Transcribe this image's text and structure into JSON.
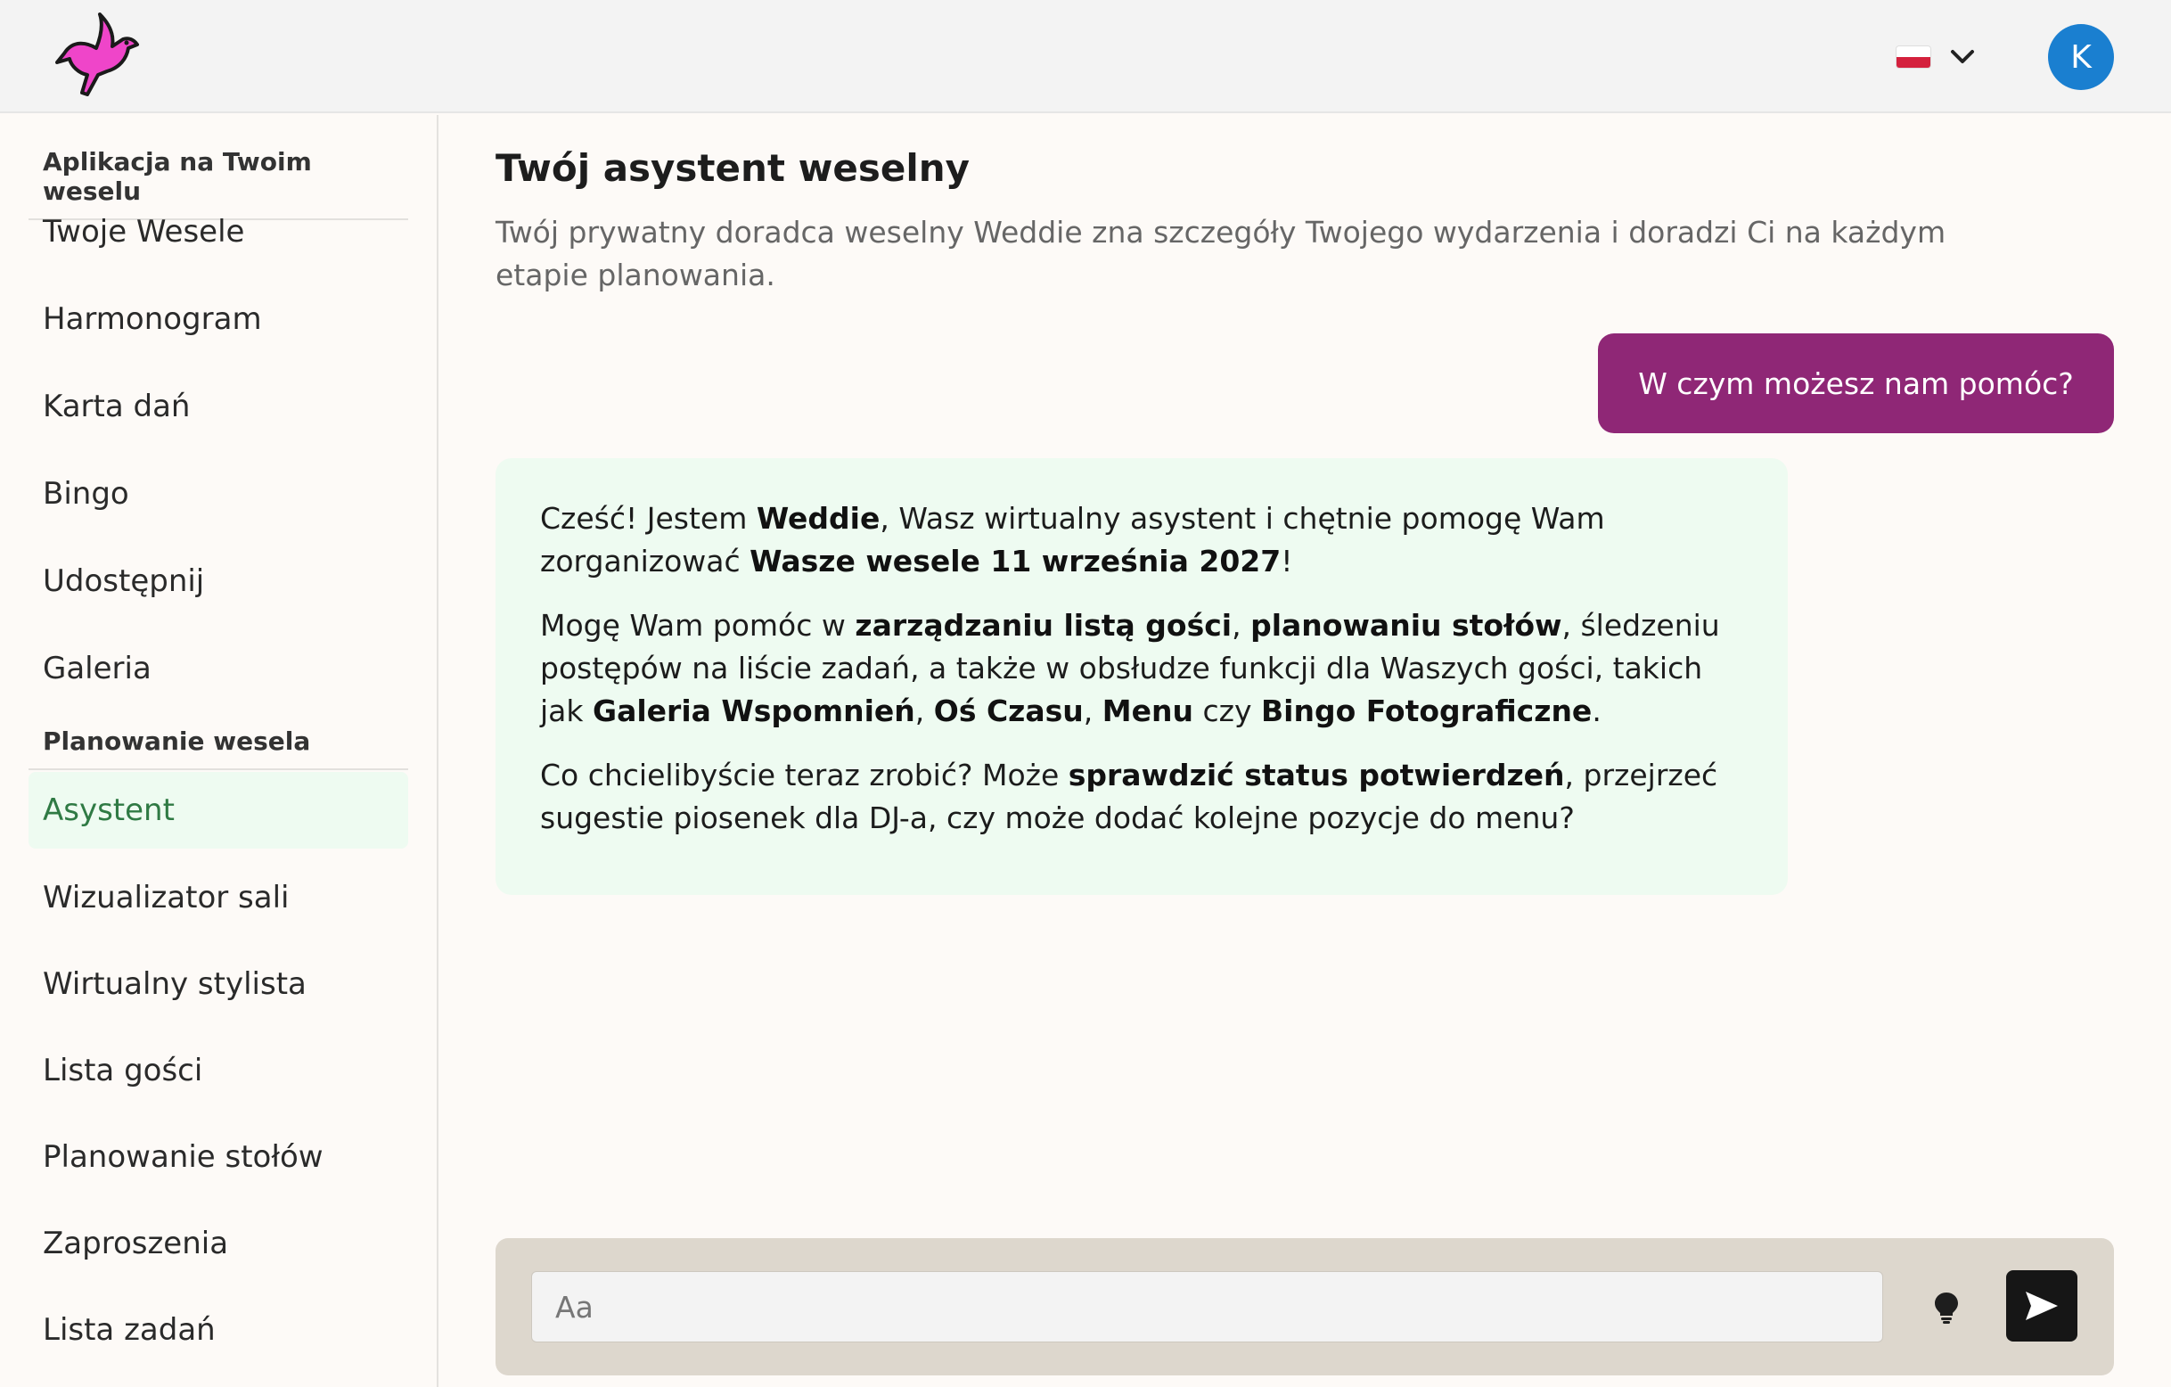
{
  "header": {
    "logo_icon": "dove-icon",
    "language_flag": "poland-flag-icon",
    "avatar_initial": "K",
    "accent_color": "#8f2776",
    "avatar_color": "#1a7fd0"
  },
  "sidebar": {
    "section1_title": "Aplikacja na Twoim weselu",
    "section1_items": [
      "Twoje Wesele",
      "Harmonogram",
      "Karta dań",
      "Bingo",
      "Udostępnij",
      "Galeria"
    ],
    "section2_title": "Planowanie wesela",
    "section2_items": [
      "Asystent",
      "Wizualizator sali",
      "Wirtualny stylista",
      "Lista gości",
      "Planowanie stołów",
      "Zaproszenia",
      "Lista zadań"
    ],
    "active_item": "Asystent"
  },
  "main": {
    "title": "Twój asystent weselny",
    "subtitle": "Twój prywatny doradca weselny Weddie zna szczegóły Twojego wydarzenia i doradzi Ci na każdym etapie planowania.",
    "user_message": "W czym możesz nam pomóc?",
    "bot_p1": {
      "a": "Cześć! Jestem ",
      "b": "Weddie",
      "c": ", Wasz wirtualny asystent i chętnie pomogę Wam zorganizować ",
      "d": "Wasze wesele 11 września 2027",
      "e": "!"
    },
    "bot_p2": {
      "a": "Mogę Wam pomóc w ",
      "b": "zarządzaniu listą gości",
      "c": ", ",
      "d": "planowaniu stołów",
      "e": ", śledzeniu postępów na liście zadań, a także w obsłudze funkcji dla Waszych gości, takich jak ",
      "f": "Galeria Wspomnień",
      "g": ", ",
      "h": "Oś Czasu",
      "i": ", ",
      "j": "Menu",
      "k": " czy ",
      "l": "Bingo Fotograficzne",
      "m": "."
    },
    "bot_p3": {
      "a": "Co chcielibyście teraz zrobić? Może ",
      "b": "sprawdzić status potwierdzeń",
      "c": ", przejrzeć sugestie piosenek dla DJ-a, czy może dodać kolejne pozycje do menu?"
    }
  },
  "composer": {
    "placeholder": "Aa",
    "value": "",
    "bulb_icon": "lightbulb-icon",
    "send_icon": "send-icon"
  }
}
